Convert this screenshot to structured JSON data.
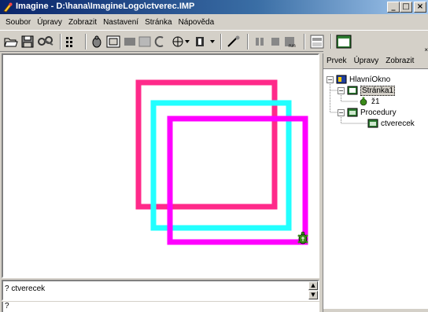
{
  "window": {
    "title": "Imagine - D:\\hana\\ImagineLogo\\ctverec.IMP",
    "minimize_label": "_",
    "maximize_label": "□",
    "close_label": "×"
  },
  "menu": {
    "items": [
      "Soubor",
      "Úpravy",
      "Zobrazit",
      "Nastavení",
      "Stránka",
      "Nápověda"
    ]
  },
  "toolbar": {
    "icons": [
      "open-folder-icon",
      "save-icon",
      "scissors-icon",
      "grid-icon",
      "turtle-icon",
      "button-icon",
      "slider-icon",
      "text-icon",
      "net-icon",
      "shape-icon",
      "paint-icon",
      "pause-icon",
      "stop-icon",
      "run-icon",
      "page-icon",
      "window-icon"
    ]
  },
  "canvas": {
    "turtle_icon": "turtle-icon",
    "squares": [
      {
        "color": "#ff2a8a"
      },
      {
        "color": "#22ffff"
      },
      {
        "color": "#ff00ff"
      }
    ]
  },
  "command": {
    "history": "? ctverecek",
    "prompt": "?"
  },
  "panel": {
    "close_label": "×",
    "menu": [
      "Prvek",
      "Úpravy",
      "Zobrazit"
    ],
    "tree": {
      "root": "HlavníOkno",
      "page": "Stránka1",
      "turtle": "ž1",
      "procedures": "Procedury",
      "procedure": "ctverecek"
    }
  }
}
